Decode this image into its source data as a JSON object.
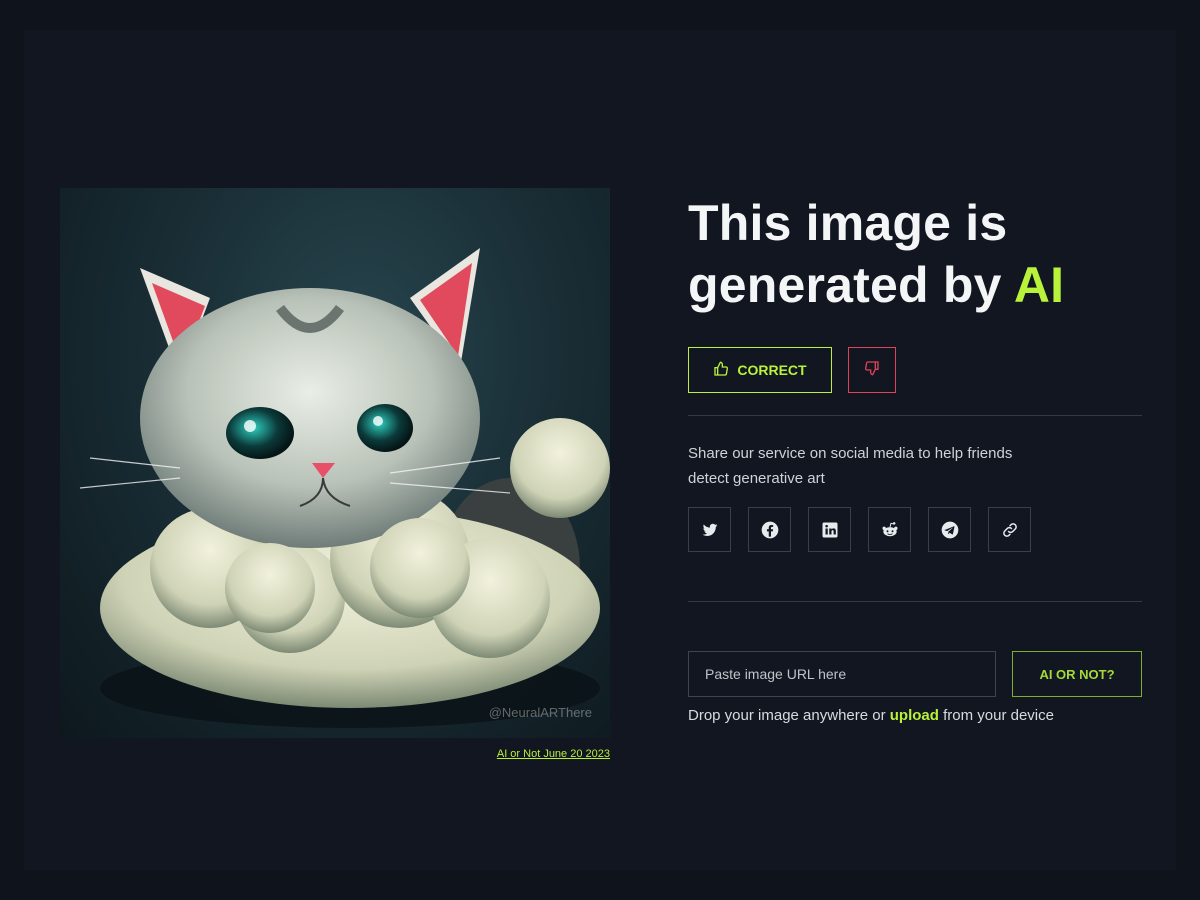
{
  "headline": {
    "line1": "This image is",
    "line2_prefix": "generated by",
    "line2_highlight": "AI"
  },
  "feedback": {
    "correct_label": "CORRECT"
  },
  "share": {
    "text_line1": "Share our service on social media to help friends",
    "text_line2": "detect generative art",
    "icons": [
      "twitter-icon",
      "facebook-icon",
      "linkedin-icon",
      "reddit-icon",
      "telegram-icon",
      "link-icon"
    ]
  },
  "image": {
    "watermark": "@NeuralARThere",
    "caption": "AI or Not June 20 2023"
  },
  "check": {
    "placeholder": "Paste image URL here",
    "button_label": "AI OR NOT?",
    "drop_prefix": "Drop your image anywhere or",
    "drop_link": "upload",
    "drop_suffix": "from your device"
  },
  "colors": {
    "accent": "#b9f23a",
    "danger": "#e0425a",
    "background": "#0f131b"
  }
}
